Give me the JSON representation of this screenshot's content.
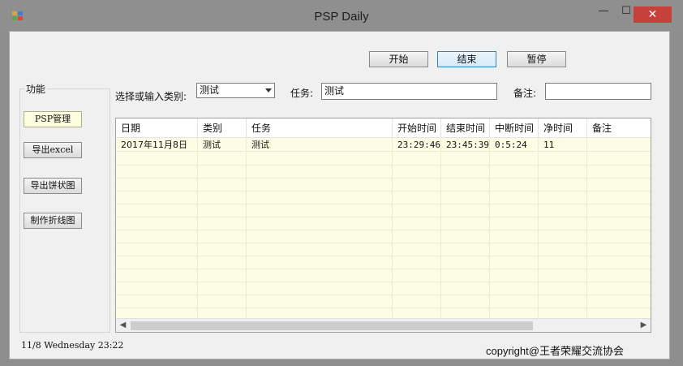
{
  "window": {
    "title": "PSP Daily",
    "minimize_glyph": "—",
    "maximize_glyph": "☐",
    "close_glyph": "✕"
  },
  "toolbar": {
    "start_label": "开始",
    "end_label": "结束",
    "pause_label": "暂停"
  },
  "sidebar": {
    "group_label": "功能",
    "items": [
      {
        "label": "PSP管理"
      },
      {
        "label": "导出excel"
      },
      {
        "label": "导出饼状图"
      },
      {
        "label": "制作折线图"
      }
    ]
  },
  "form": {
    "category_label": "选择或输入类别:",
    "category_value": "测试",
    "task_label": "任务:",
    "task_value": "测试",
    "note_label": "备注:",
    "note_value": ""
  },
  "table": {
    "columns": [
      "日期",
      "类别",
      "任务",
      "开始时间",
      "结束时间",
      "中断时间",
      "净时间",
      "备注"
    ],
    "rows": [
      [
        "2017年11月8日",
        "测试",
        "测试",
        "23:29:46",
        "23:45:39",
        "0:5:24",
        "11",
        ""
      ]
    ]
  },
  "status": {
    "datetime": "11/8  Wednesday 23:22",
    "copyright": "copyright@王者荣耀交流协会"
  },
  "colors": {
    "grid_background": "#fdfde6",
    "close_button": "#c7413a"
  }
}
